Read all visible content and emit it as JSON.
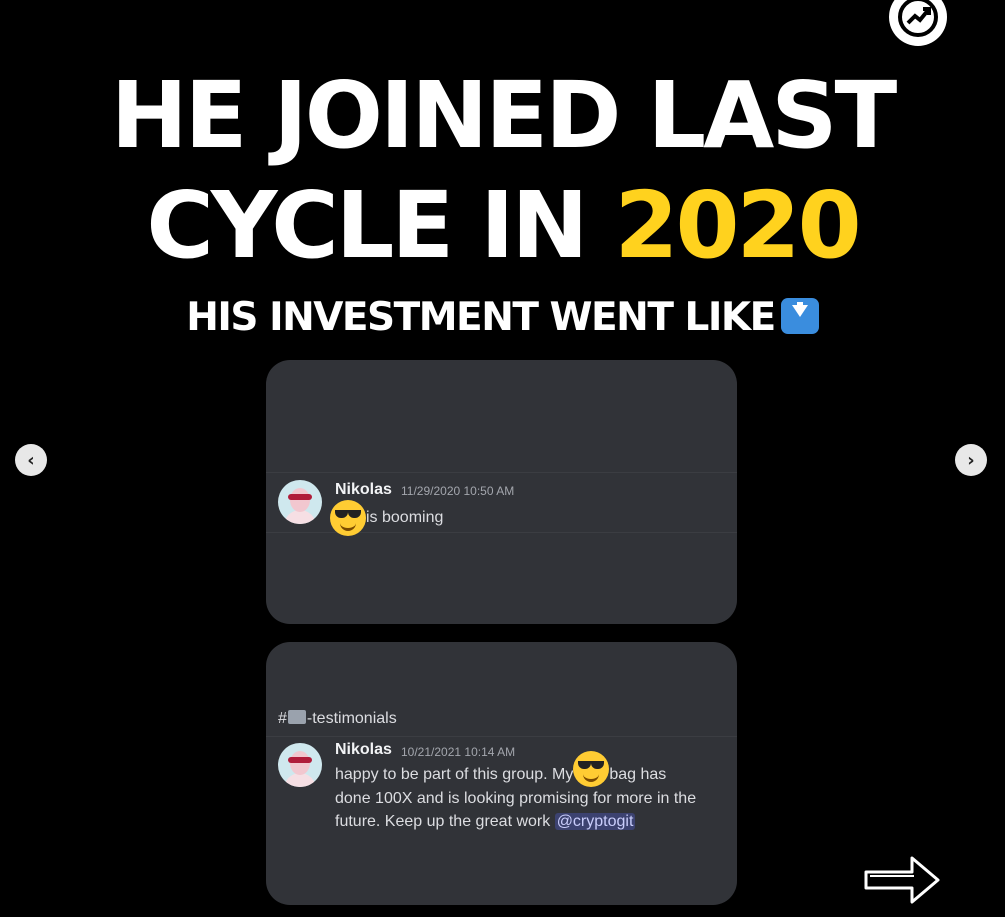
{
  "brand": {
    "logo_icon": "chart-logo-icon"
  },
  "headline": {
    "line1": "HE JOINED LAST",
    "line2_prefix": "CYCLE IN ",
    "line2_year": "2020",
    "subheading": "HIS INVESTMENT WENT LIKE",
    "accent_color": "#ffd21e"
  },
  "carousel": {
    "prev_icon": "chevron-left-icon",
    "next_icon": "chevron-right-icon"
  },
  "message1": {
    "author": "Nikolas",
    "timestamp": "11/29/2020 10:50 AM",
    "text": "is booming"
  },
  "message2": {
    "channel_prefix": "#",
    "channel_name": "-testimonials",
    "author": "Nikolas",
    "timestamp": "10/21/2021 10:14 AM",
    "text_line1_a": "happy to be part of this group. My",
    "text_line1_b": "bag has",
    "text_line2": "done 100X and is looking promising for more in the",
    "text_line3": "future. Keep up the great work ",
    "mention": "@cryptogit"
  },
  "colors": {
    "card_bg": "#313338",
    "mention_bg": "#3c4270"
  }
}
